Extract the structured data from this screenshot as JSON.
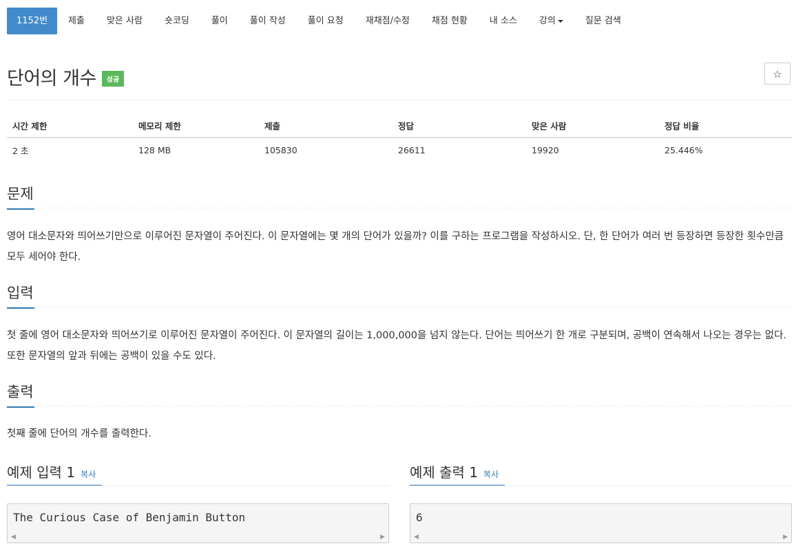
{
  "nav": {
    "items": [
      {
        "label": "1152번",
        "active": true
      },
      {
        "label": "제출"
      },
      {
        "label": "맞은 사람"
      },
      {
        "label": "숏코딩"
      },
      {
        "label": "풀이"
      },
      {
        "label": "풀이 작성"
      },
      {
        "label": "풀이 요청"
      },
      {
        "label": "재채점/수정"
      },
      {
        "label": "채점 현황"
      },
      {
        "label": "내 소스"
      },
      {
        "label": "강의",
        "dropdown": true
      },
      {
        "label": "질문 검색"
      }
    ]
  },
  "problem": {
    "title": "단어의 개수",
    "status_badge": "성공",
    "star_icon": "☆"
  },
  "info_table": {
    "headers": [
      "시간 제한",
      "메모리 제한",
      "제출",
      "정답",
      "맞은 사람",
      "정답 비율"
    ],
    "values": [
      "2 초",
      "128 MB",
      "105830",
      "26611",
      "19920",
      "25.446%"
    ]
  },
  "sections": {
    "problem_head": "문제",
    "problem_text": "영어 대소문자와 띄어쓰기만으로 이루어진 문자열이 주어진다. 이 문자열에는 몇 개의 단어가 있을까? 이를 구하는 프로그램을 작성하시오. 단, 한 단어가 여러 번 등장하면 등장한 횟수만큼 모두 세어야 한다.",
    "input_head": "입력",
    "input_text": "첫 줄에 영어 대소문자와 띄어쓰기로 이루어진 문자열이 주어진다. 이 문자열의 길이는 1,000,000을 넘지 않는다. 단어는 띄어쓰기 한 개로 구분되며, 공백이 연속해서 나오는 경우는 없다. 또한 문자열의 앞과 뒤에는 공백이 있을 수도 있다.",
    "output_head": "출력",
    "output_text": "첫째 줄에 단어의 개수를 출력한다."
  },
  "examples": {
    "input_head": "예제 입력 1",
    "output_head": "예제 출력 1",
    "copy_label": "복사",
    "input_value": "The Curious Case of Benjamin Button",
    "output_value": "6"
  },
  "colors": {
    "nav_active": "#428bca",
    "badge_success": "#5cb85c",
    "accent": "#337ab7"
  }
}
